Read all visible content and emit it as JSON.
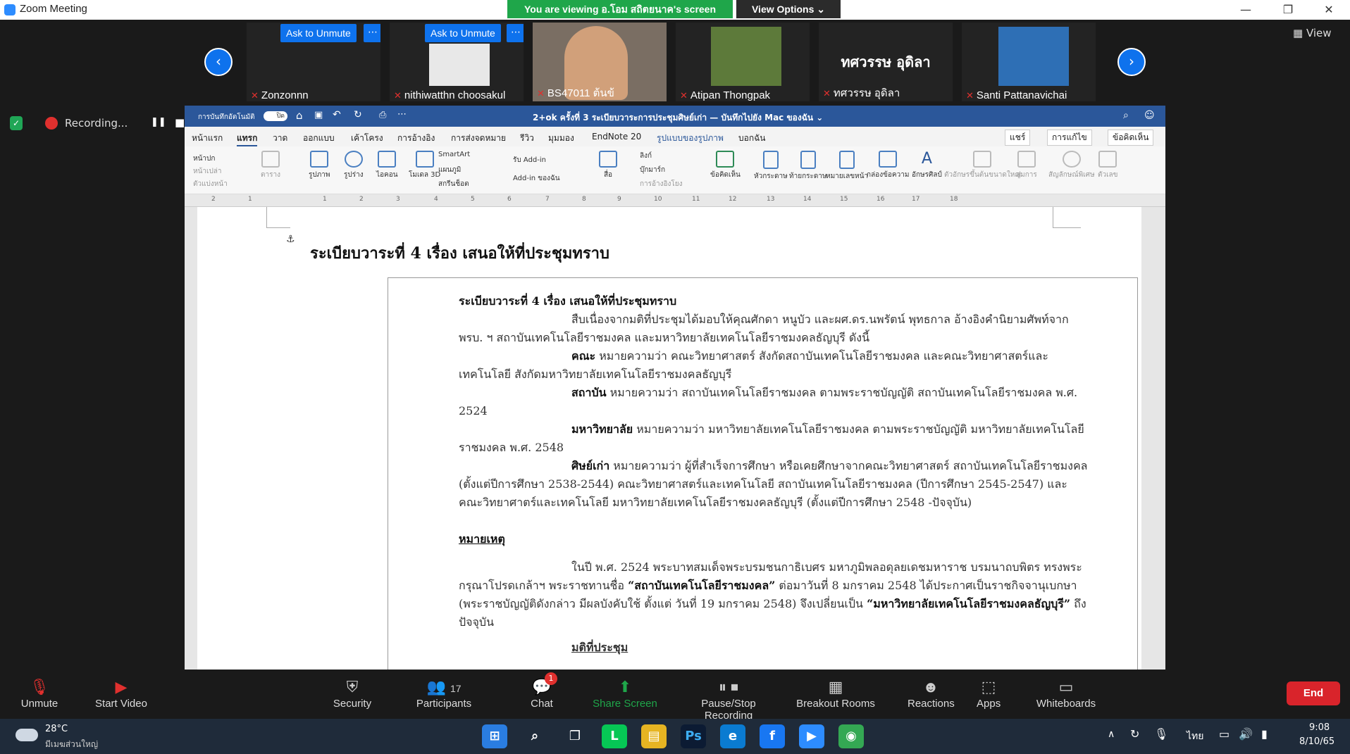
{
  "window": {
    "title": "Zoom Meeting",
    "minimize": "—",
    "restore": "❐",
    "close": "✕"
  },
  "share": {
    "banner": "You are viewing อ.โอม สถิตยนาค's screen",
    "view_options": "View Options ⌄"
  },
  "participants": [
    {
      "name": "Zonzonnn",
      "ask": "Ask to Unmute",
      "more": "⋯"
    },
    {
      "name": "nithiwatthn choosakul",
      "ask": "Ask to Unmute",
      "more": "⋯"
    },
    {
      "name": "BS47011 ต้นข้"
    },
    {
      "name": "Atipan Thongpak"
    },
    {
      "name": "ทศวรรษ อุดิลา",
      "big": "ทศวรรษ อุดิลา"
    },
    {
      "name": "Santi Pattanavichai"
    }
  ],
  "view_button": "View",
  "recording": {
    "label": "Recording...",
    "pause": "❚❚",
    "stop": "■"
  },
  "word": {
    "autosave": "การบันทึกอัตโนมัติ",
    "toggle": "ปิด",
    "doc_title": "2+ok ครั้งที่ 3  ระเบียบวาระการประชุมศิษย์เก่า — บันทึกไปยัง Mac ของฉัน ⌄",
    "menu": [
      "หน้าแรก",
      "แทรก",
      "วาด",
      "ออกแบบ",
      "เค้าโครง",
      "การอ้างอิง",
      "การส่งจดหมาย",
      "รีวิว",
      "มุมมอง",
      "EndNote 20",
      "รูปแบบของรูปภาพ",
      "บอกฉัน"
    ],
    "share_btn": "แชร์",
    "edit_btn": "การแก้ไข",
    "comment_btn": "ข้อคิดเห็น",
    "ribbon": [
      "หน้าปก",
      "หน้าเปล่า",
      "ตัวแบ่งหน้า",
      "ตาราง",
      "รูปภาพ",
      "รูปร่าง",
      "ไอคอน",
      "โมเดล 3D",
      "SmartArt",
      "แผนภูมิ",
      "สกรีนช็อต",
      "รับ Add-in",
      "Add-in ของฉัน",
      "สื่อ",
      "ลิงก์",
      "บุ๊กมาร์ก",
      "การอ้างอิงโยง",
      "ข้อคิดเห็น",
      "หัวกระดาษ",
      "ท้ายกระดาษ",
      "หมายเลขหน้า",
      "กล่องข้อความ",
      "อักษรศิลป์",
      "ตัวอักษรขึ้นต้นขนาดใหญ่",
      "สมการ",
      "สัญลักษณ์พิเศษ",
      "ตัวเลข"
    ],
    "ruler": [
      "2",
      "1",
      "1",
      "2",
      "3",
      "4",
      "5",
      "6",
      "7",
      "8",
      "9",
      "10",
      "11",
      "12",
      "13",
      "14",
      "15",
      "16",
      "17",
      "18"
    ],
    "page_heading": "ระเบียบวาระที่  4  เรื่อง   เสนอให้ที่ประชุมทราบ",
    "tb_heading": "ระเบียบวาระที่  4  เรื่อง เสนอให้ที่ประชุมทราบ",
    "p1": "สืบเนื่องจากมติที่ประชุมได้มอบให้คุณศักดา หนูบัว และผศ.ดร.นพรัตน์ พุทธกาล อ้างอิงคำนิยามศัพท์จากพรบ. ฯ สถาบันเทคโนโลยีราชมงคล และมหาวิทยาลัยเทคโนโลยีราชมงคลธัญบุรี ดังนี้",
    "p2_term": "คณะ",
    "p2": " หมายความว่า คณะวิทยาศาสตร์ สังกัดสถาบันเทคโนโลยีราชมงคล และคณะวิทยาศาสตร์และเทคโนโลยี สังกัดมหาวิทยาลัยเทคโนโลยีราชมงคลธัญบุรี",
    "p3_term": "สถาบัน",
    "p3": " หมายความว่า สถาบันเทคโนโลยีราชมงคล ตามพระราชบัญญัติ สถาบันเทคโนโลยีราชมงคล พ.ศ. 2524",
    "p4_term": "มหาวิทยาลัย",
    "p4": " หมายความว่า มหาวิทยาลัยเทคโนโลยีราชมงคล ตามพระราชบัญญัติ มหาวิทยาลัยเทคโนโลยีราชมงคล พ.ศ. 2548",
    "p5_term": "ศิษย์เก่า",
    "p5": " หมายความว่า ผู้ที่สำเร็จการศึกษา หรือเคยศึกษาจากคณะวิทยาศาสตร์ สถาบันเทคโนโลยีราชมงคล (ตั้งแต่ปีการศึกษา 2538-2544) คณะวิทยาศาสตร์และเทคโนโลยี สถาบันเทคโนโลยีราชมงคล (ปีการศึกษา 2545-2547) และคณะวิทยาศาตร์และเทคโนโลยี มหาวิทยาลัยเทคโนโลยีราชมงคลธัญบุรี (ตั้งแต่ปีการศึกษา 2548 -ปัจจุบัน)",
    "note": "หมายเหตุ",
    "p6a": "ในปี พ.ศ. 2524 พระบาทสมเด็จพระบรมชนกาธิเบศร มหาภูมิพลอดุลยเดชมหาราช บรมนาถบพิตร ทรงพระกรุณาโปรดเกล้าฯ พระราชทานชื่อ ",
    "p6b": "“สถาบันเทคโนโลยีราชมงคล”",
    "p6c": " ต่อมาวันที่ 8 มกราคม 2548 ได้ประกาศเป็นราชกิจจานุเบกษา (พระราชบัญญัติดังกล่าว มีผลบังคับใช้ ตั้งแต่ วันที่ 19 มกราคม 2548) จึงเปลี่ยนเป็น ",
    "p6d": "“มหาวิทยาลัยเทคโนโลยีราชมงคลธัญบุรี”",
    "p6e": " ถึงปัจจุบัน",
    "cut": "มติที่ประชุม"
  },
  "toolbar": {
    "unmute": "Unmute",
    "start_video": "Start Video",
    "security": "Security",
    "participants": "Participants",
    "participants_count": "17",
    "chat": "Chat",
    "chat_badge": "1",
    "share_screen": "Share Screen",
    "recording": "Pause/Stop Recording",
    "breakout": "Breakout Rooms",
    "reactions": "Reactions",
    "apps": "Apps",
    "whiteboards": "Whiteboards",
    "end": "End"
  },
  "taskbar": {
    "temp": "28°C",
    "weather": "มีเมฆส่วนใหญ่",
    "lang": "ไทย",
    "time": "9:08",
    "date": "8/10/65"
  }
}
